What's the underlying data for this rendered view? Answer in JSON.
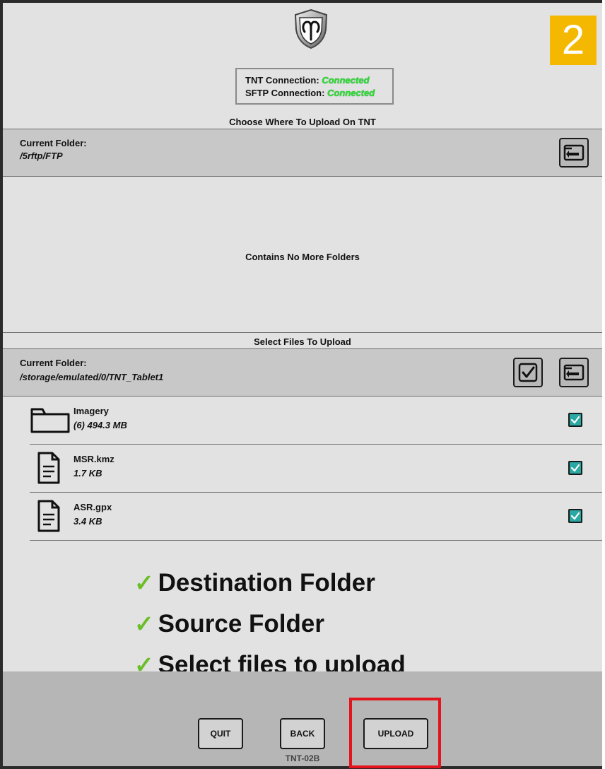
{
  "step_badge": "2",
  "logo": {
    "icon": "aries-shield-logo"
  },
  "connection": {
    "tnt_label": "TNT Connection:",
    "tnt_status": "Connected",
    "sftp_label": "SFTP Connection:",
    "sftp_status": "Connected",
    "status_color": "#28e028"
  },
  "destination": {
    "title": "Choose Where To Upload On TNT",
    "current_folder_label": "Current Folder:",
    "path": "/5rftp/FTP",
    "empty_message": "Contains No More Folders"
  },
  "source": {
    "title": "Select Files To Upload",
    "current_folder_label": "Current Folder:",
    "path": "/storage/emulated/0/TNT_Tablet1",
    "files": [
      {
        "name": "Imagery",
        "size": "(6) 494.3 MB",
        "icon": "folder-icon",
        "checked": true
      },
      {
        "name": "MSR.kmz",
        "size": "1.7 KB",
        "icon": "document-icon",
        "checked": true
      },
      {
        "name": "ASR.gpx",
        "size": "3.4 KB",
        "icon": "document-icon",
        "checked": true
      }
    ]
  },
  "checklist": [
    "Destination Folder",
    "Source Folder",
    "Select files to upload"
  ],
  "footer": {
    "quit_label": "QUIT",
    "back_label": "BACK",
    "upload_label": "UPLOAD",
    "device_name": "TNT-02B"
  },
  "colors": {
    "badge": "#f5b800",
    "highlight": "#e3141e",
    "check": "#6abf28",
    "checkbox": "#2aa8a3"
  }
}
